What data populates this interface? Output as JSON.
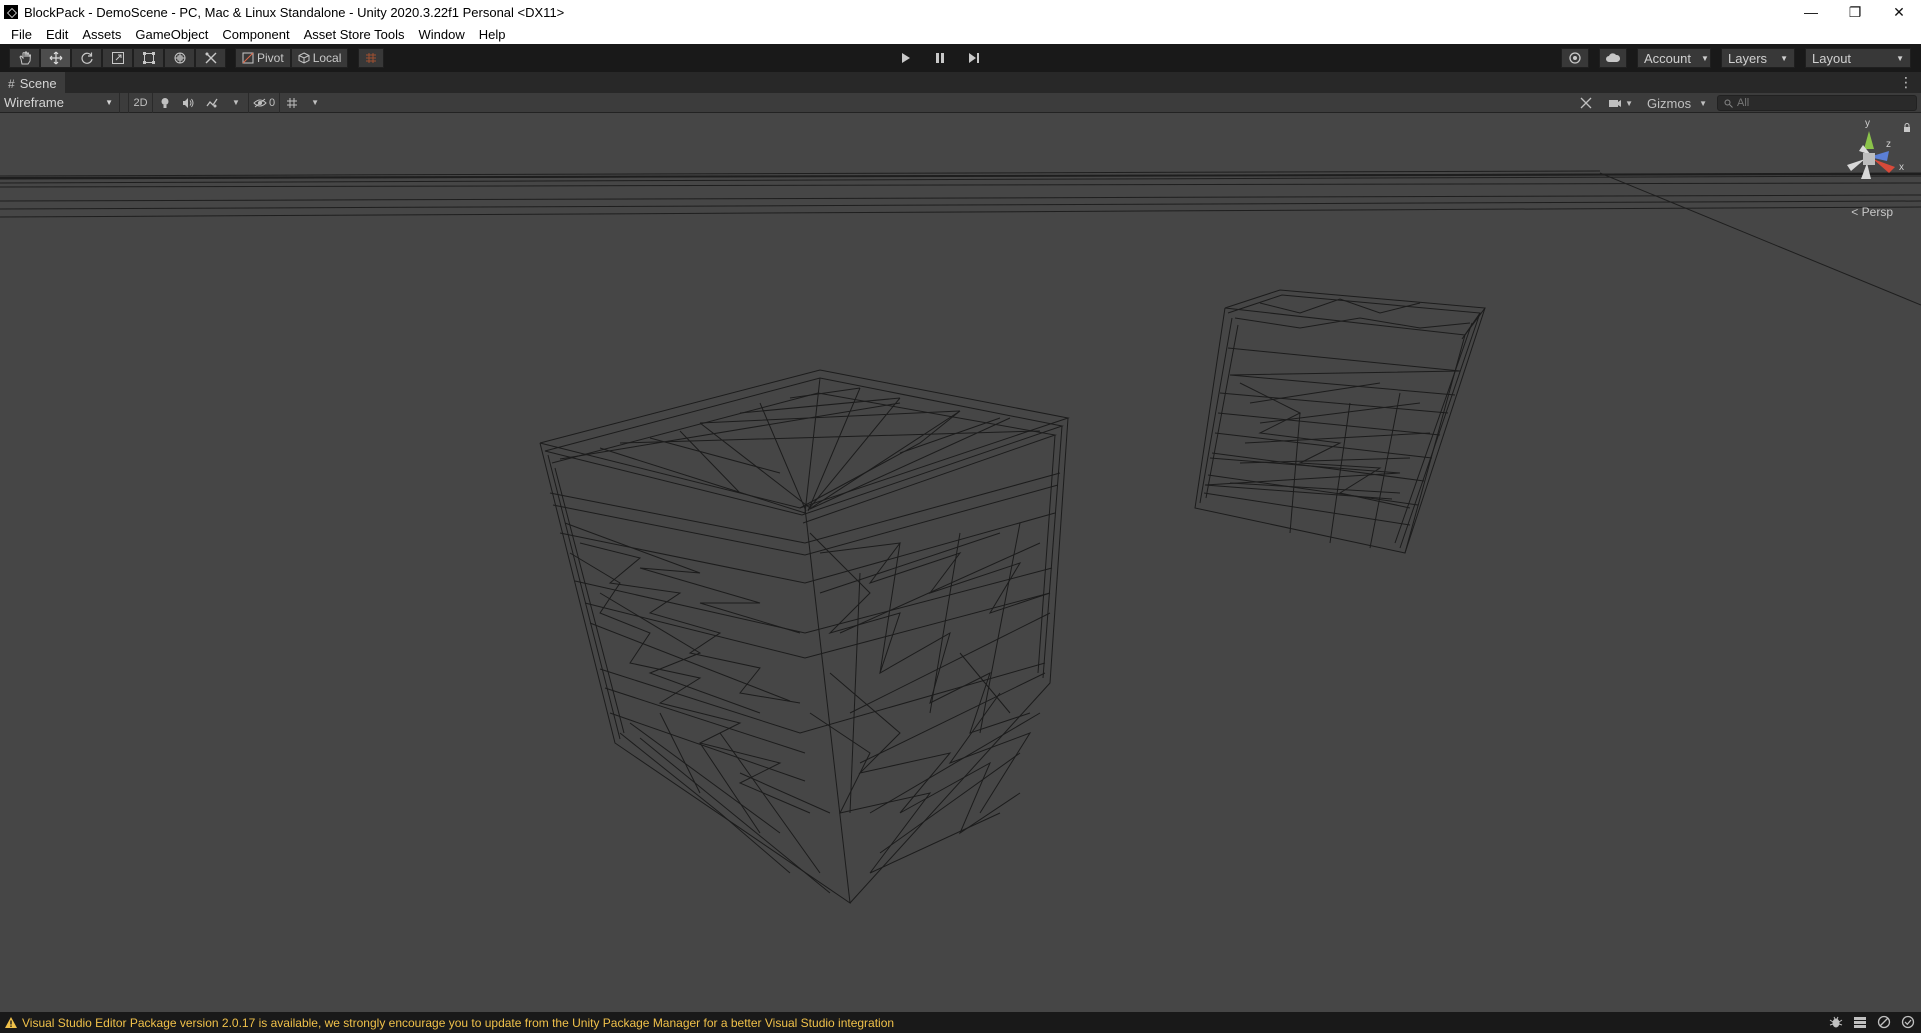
{
  "window": {
    "title": "BlockPack - DemoScene - PC, Mac & Linux Standalone - Unity 2020.3.22f1 Personal <DX11>",
    "controls": {
      "minimize": "—",
      "restore": "❐",
      "close": "✕"
    }
  },
  "menu": [
    "File",
    "Edit",
    "Assets",
    "GameObject",
    "Component",
    "Asset Store Tools",
    "Window",
    "Help"
  ],
  "toolbar": {
    "tools": [
      "hand-tool",
      "move-tool",
      "rotate-tool",
      "scale-tool",
      "rect-tool",
      "transform-tool",
      "custom-editor-tool"
    ],
    "active_tool": "move-tool",
    "pivot_label": "Pivot",
    "local_label": "Local",
    "account_label": "Account",
    "layers_label": "Layers",
    "layout_label": "Layout"
  },
  "scene": {
    "tab_label": "Scene",
    "draw_mode": "Wireframe",
    "mode_2d_label": "2D",
    "hidden_count": "0",
    "gizmos_label": "Gizmos",
    "search_placeholder": "All",
    "projection_label": "Persp",
    "axis_labels": {
      "y": "y",
      "z": "z",
      "x": "x"
    }
  },
  "status": {
    "message": "Visual Studio Editor Package version 2.0.17 is available, we strongly encourage you to update from the Unity Package Manager for a better Visual Studio integration"
  },
  "colors": {
    "viewport_bg": "#464646",
    "toolbar_bg": "#191919",
    "wire": "#1c1c1c",
    "warning_text": "#f0c14a"
  }
}
